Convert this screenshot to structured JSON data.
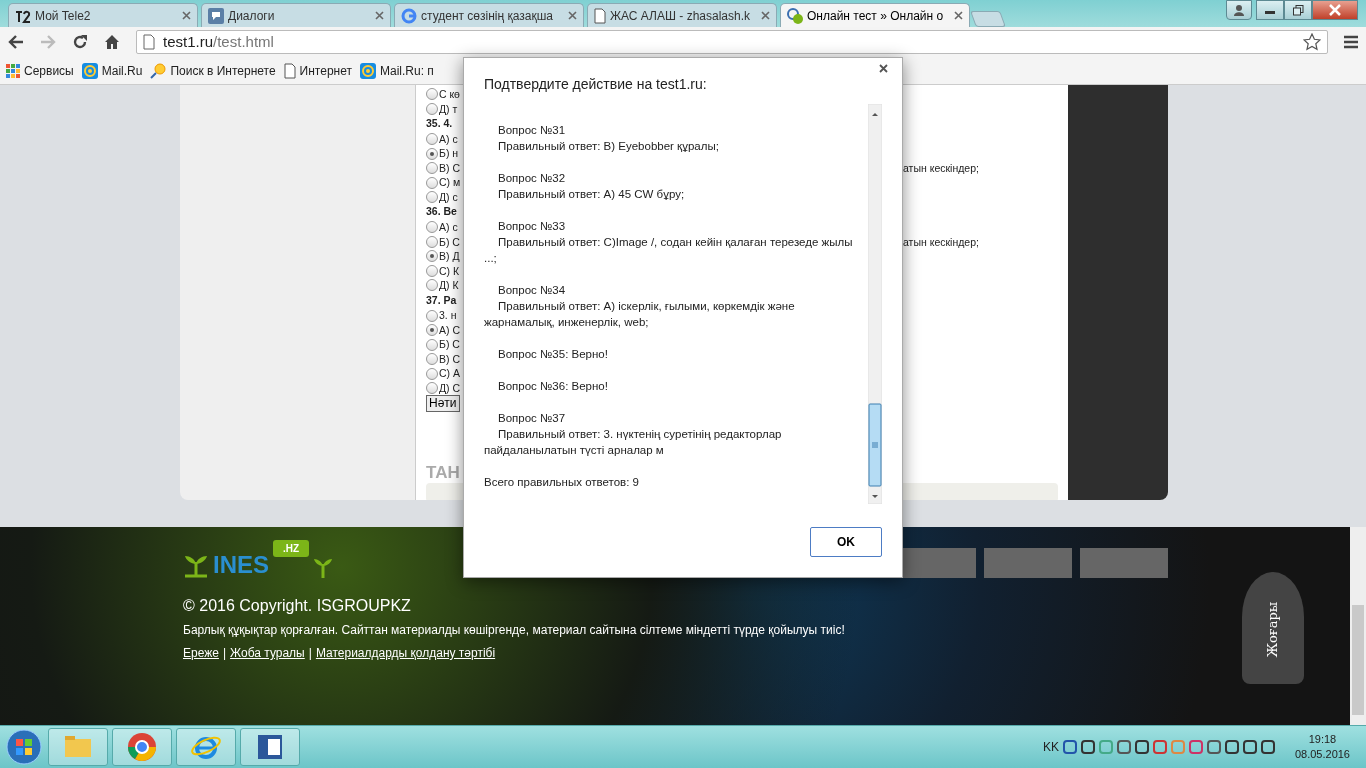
{
  "browser": {
    "tabs": [
      {
        "label": "Мой Tele2",
        "kind": "tele",
        "selected": false
      },
      {
        "label": "Диалоги",
        "kind": "chat",
        "selected": false
      },
      {
        "label": "студент сөзінің қазақша",
        "kind": "google",
        "selected": false
      },
      {
        "label": "ЖАС АЛАШ - zhasalash.k",
        "kind": "page",
        "selected": false
      },
      {
        "label": "Онлайн тест » Онлайн о",
        "kind": "rings",
        "selected": true
      }
    ],
    "address": {
      "host": "test1.ru",
      "path": "/test.html"
    },
    "bookmarks": [
      {
        "label": "Сервисы",
        "kind": "apps"
      },
      {
        "label": "Mail.Ru",
        "kind": "mail"
      },
      {
        "label": "Поиск в Интернете",
        "kind": "search"
      },
      {
        "label": "Интернет",
        "kind": "page"
      },
      {
        "label": "Mail.Ru: п",
        "kind": "mail"
      }
    ]
  },
  "page": {
    "questions": [
      {
        "options": [
          {
            "text": "С кө",
            "selected": false
          },
          {
            "text": "Д) т",
            "selected": false
          }
        ]
      },
      {
        "heading": "35. 4.",
        "options": [
          {
            "text": "А) с",
            "selected": false
          },
          {
            "text": "Б) н",
            "selected": true
          },
          {
            "text": "В) С",
            "after_dialog": "атын кескіндер;",
            "selected": false
          },
          {
            "text": "С) м",
            "selected": false
          },
          {
            "text": "Д) с",
            "selected": false
          }
        ]
      },
      {
        "heading": "36. Ве",
        "options": [
          {
            "text": "А) с",
            "selected": false
          },
          {
            "text": "Б) С",
            "after_dialog": "атын кескіндер;",
            "selected": false
          },
          {
            "text": "В) Д",
            "selected": true
          },
          {
            "text": "С) К",
            "selected": false
          },
          {
            "text": "Д) К",
            "selected": false
          }
        ]
      },
      {
        "heading": "37. Ра",
        "options": [
          {
            "text": "3. н",
            "selected": false
          },
          {
            "text": "А) С",
            "selected": true
          },
          {
            "text": "Б) С",
            "selected": false
          },
          {
            "text": "В) С",
            "selected": false
          },
          {
            "text": "С) А",
            "selected": false
          },
          {
            "text": "Д) С",
            "selected": false
          }
        ]
      }
    ],
    "result_button": "Нәти",
    "section_heading": "ТАН"
  },
  "dialog": {
    "title": "Подтвердите действие на test1.ru:",
    "entries": [
      {
        "question": "Вопрос №31",
        "answer": "Правильный ответ: В) Eyebobber құралы;"
      },
      {
        "question": "Вопрос №32",
        "answer": "Правильный ответ:  А) 45 CW бұру;"
      },
      {
        "question": "Вопрос №33",
        "answer": "Правильный ответ: С)Image /, содан кейін қалаған терезеде жылы ...;"
      },
      {
        "question": "Вопрос №34",
        "answer": "Правильный ответ:  А) іскерлік, ғылыми, көркемдік және жарнамалық, инженерлік, web;"
      },
      {
        "question": "Вопрос №35: Верно!"
      },
      {
        "question": "Вопрос №36: Верно!"
      },
      {
        "question": "Вопрос №37",
        "answer": "Правильный ответ: 3. нүктенің суретінің редакторлар пайдаланылатын түсті арналар м"
      }
    ],
    "total": "Всего правильных ответов: 9",
    "ok": "OK"
  },
  "footer": {
    "logo_text": "INES",
    "logo_badge": ".HZ",
    "copyright": "© 2016 Copyright. ISGROUPKZ",
    "notice": "Барлық құқықтар қорғалған. Сайттан материалды көшіргенде, материал сайтына сілтеме міндетті түрде қойылуы тиіс!",
    "links": [
      "Ереже",
      "Жоба туралы",
      "Материалдарды қолдану тәртібі"
    ],
    "link_separator": "|",
    "up_label": "Жоғары"
  },
  "taskbar": {
    "apps": [
      {
        "kind": "explorer"
      },
      {
        "kind": "chrome"
      },
      {
        "kind": "ie"
      },
      {
        "kind": "word"
      }
    ],
    "language": "KK",
    "time": "19:18",
    "date": "08.05.2016"
  }
}
